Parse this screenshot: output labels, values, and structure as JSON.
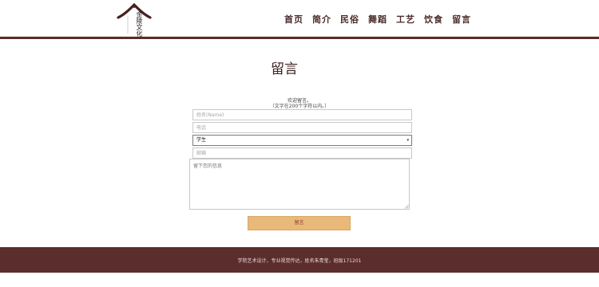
{
  "logo": {
    "text": "金陵文化",
    "icon": "roof-icon"
  },
  "nav": {
    "items": [
      {
        "label": "首页"
      },
      {
        "label": "简介"
      },
      {
        "label": "民俗"
      },
      {
        "label": "舞蹈"
      },
      {
        "label": "工艺"
      },
      {
        "label": "饮食"
      },
      {
        "label": "留言"
      }
    ]
  },
  "main": {
    "title": "留言",
    "intro_line1": "欢迎留言。",
    "intro_line2": "（文字在200个字符以内。）"
  },
  "form": {
    "name_placeholder": "姓名(Name)",
    "phone_placeholder": "电话",
    "role_selected": "学生",
    "email_placeholder": "邮箱",
    "message_placeholder": "留下您的信息",
    "submit_label": "留言"
  },
  "footer": {
    "text": "学院艺术设计，专业视觉传达，姓名朱青莹，班级171201"
  },
  "colors": {
    "brand": "#5b2a2a",
    "button": "#e9b97a",
    "footer_bg": "#5b2d2c"
  }
}
